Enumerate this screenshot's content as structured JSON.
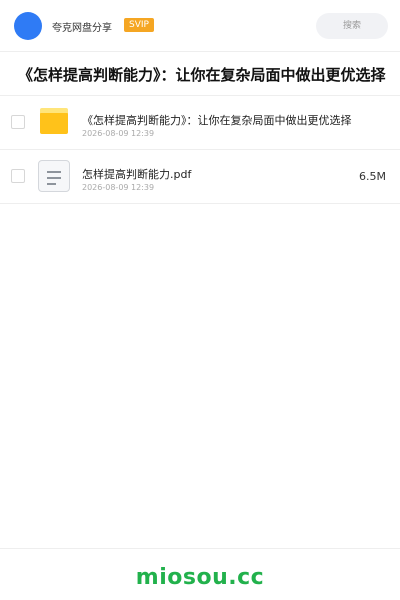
{
  "header": {
    "brand": "夸克网盘分享",
    "badge": "SVIP",
    "search_placeholder": "搜索"
  },
  "page": {
    "title": "《怎样提高判断能力》：让你在复杂局面中做出更优选择"
  },
  "files": [
    {
      "name": "《怎样提高判断能力》：让你在复杂局面中做出更优选择",
      "date": "2026-08-09 12:39",
      "size": "",
      "icon": "folder-icon"
    },
    {
      "name": "怎样提高判断能力.pdf",
      "date": "2026-08-09 12:39",
      "size": "6.5M",
      "icon": "document-icon"
    }
  ],
  "footer": {
    "logo_text": "miosou.cc"
  },
  "colors": {
    "accent_blue": "#2f7bf5",
    "svip_orange": "#f5a623",
    "folder_yellow": "#ffc21a",
    "logo_green": "#22b14c"
  }
}
